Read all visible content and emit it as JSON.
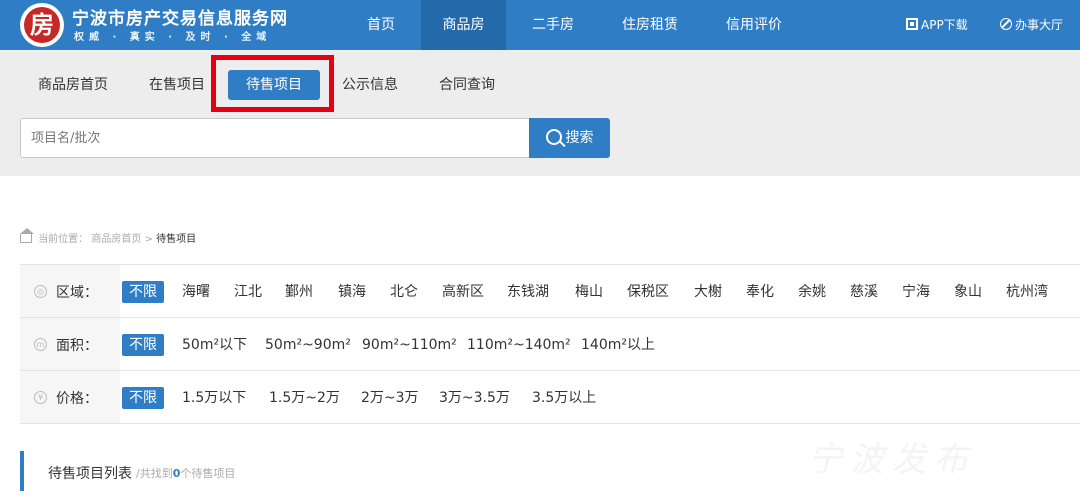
{
  "header": {
    "logo_text": "房",
    "title": "宁波市房产交易信息服务网",
    "tagline": "权威 · 真实 · 及时 · 全域",
    "nav": [
      "首页",
      "商品房",
      "二手房",
      "住房租赁",
      "信用评价"
    ],
    "active_nav": "商品房",
    "app_download": "APP下载",
    "service_hall": "办事大厅"
  },
  "subnav": {
    "tabs": [
      "商品房首页",
      "在售项目",
      "待售项目",
      "公示信息",
      "合同查询"
    ],
    "active_tab": "待售项目"
  },
  "search": {
    "placeholder": "项目名/批次",
    "button_label": "搜索"
  },
  "breadcrumb": {
    "prefix": "当前位置：",
    "parent": "商品房首页",
    "separator": ">",
    "current": "待售项目"
  },
  "filters": {
    "region": {
      "label": "区域：",
      "icon": "location-icon",
      "options": [
        "不限",
        "海曙",
        "江北",
        "鄞州",
        "镇海",
        "北仑",
        "高新区",
        "东钱湖",
        "梅山",
        "保税区",
        "大榭",
        "奉化",
        "余姚",
        "慈溪",
        "宁海",
        "象山",
        "杭州湾"
      ],
      "selected": "不限"
    },
    "area": {
      "label": "面积：",
      "icon": "area-icon",
      "options": [
        "不限",
        "50m²以下",
        "50m²~90m²",
        "90m²~110m²",
        "110m²~140m²",
        "140m²以上"
      ],
      "selected": "不限"
    },
    "price": {
      "label": "价格：",
      "icon": "yen-icon",
      "options": [
        "不限",
        "1.5万以下",
        "1.5万~2万",
        "2万~3万",
        "3万~3.5万",
        "3.5万以上"
      ],
      "selected": "不限"
    }
  },
  "list": {
    "title": "待售项目列表",
    "count_prefix": "/共找到",
    "count": "0",
    "count_suffix": "个待售项目"
  },
  "watermark": "宁波发布",
  "colors": {
    "primary": "#2f7ec5",
    "highlight_border": "#e60012",
    "subnav_bg": "#ededed"
  }
}
